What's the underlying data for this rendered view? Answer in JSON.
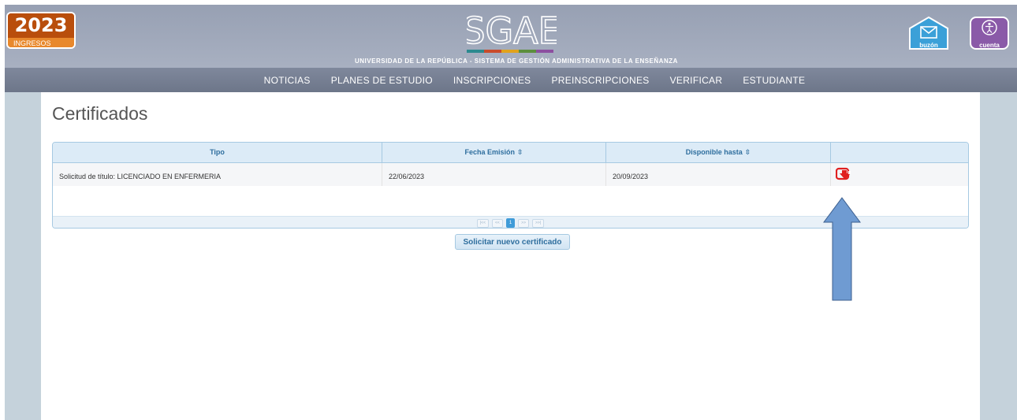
{
  "header": {
    "year": "2023",
    "year_sub": "INGRESOS",
    "logo_text": "SGAE",
    "subtitle": "UNIVERSIDAD DE LA REPÚBLICA - SISTEMA DE GESTIÓN ADMINISTRATIVA DE LA ENSEÑANZA",
    "mailbox_label": "buzón",
    "account_label": "cuenta",
    "logo_bar_colors": [
      "#2c8a8f",
      "#c94b2b",
      "#e1a21c",
      "#5c8f3d",
      "#8c4fa0"
    ]
  },
  "nav": {
    "items": [
      "NOTICIAS",
      "PLANES DE ESTUDIO",
      "INSCRIPCIONES",
      "PREINSCRIPCIONES",
      "VERIFICAR",
      "ESTUDIANTE"
    ]
  },
  "page": {
    "title": "Certificados"
  },
  "table": {
    "headers": [
      "Tipo",
      "Fecha Emisión",
      "Disponible hasta",
      ""
    ],
    "sort_icon": "⇳",
    "rows": [
      {
        "tipo": "Solicitud de título: LICENCIADO EN ENFERMERIA",
        "fecha_emision": "22/06/2023",
        "disponible_hasta": "20/09/2023",
        "action_icon": "pdf-download-icon"
      }
    ],
    "pager": {
      "first": "|<<",
      "prev": "<<",
      "current": "1",
      "next": ">>",
      "last": ">>|"
    }
  },
  "actions": {
    "request_label": "Solicitar nuevo certificado"
  },
  "colors": {
    "header_bg": "#a0a9bb",
    "nav_bg": "#767f93",
    "side_panel": "#c5d2db",
    "year_badge": "#b94e0c",
    "mailbox": "#3ba0d8",
    "account": "#8a5aa8",
    "pdf_red": "#e02020",
    "arrow_blue": "#6f9bd2"
  }
}
